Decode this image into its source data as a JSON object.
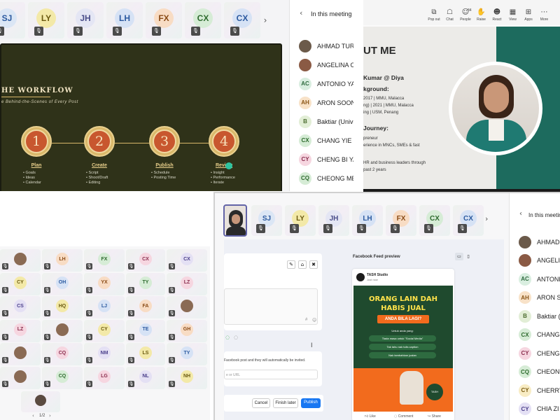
{
  "p1": {
    "tiles": [
      {
        "initials": "SJ",
        "bg": "#dbe6f5",
        "fg": "#2c5aa0"
      },
      {
        "initials": "LY",
        "bg": "#f3e9a8",
        "fg": "#6b5a10"
      },
      {
        "initials": "JH",
        "bg": "#e4e6f4",
        "fg": "#4a4e8a"
      },
      {
        "initials": "LH",
        "bg": "#d6e2f5",
        "fg": "#2c5aa0"
      },
      {
        "initials": "FX",
        "bg": "#f8dcc4",
        "fg": "#8a4b16"
      },
      {
        "initials": "CX",
        "bg": "#d6ecd6",
        "fg": "#2e6b2e"
      },
      {
        "initials": "CX",
        "bg": "#d6e2f5",
        "fg": "#2c5aa0"
      }
    ],
    "slide": {
      "title": "HE WORKFLOW",
      "subtitle": "e Behind-the-Scenes of Every Post",
      "steps": [
        {
          "num": "1",
          "title": "Plan",
          "bullets": [
            "Goals",
            "Ideas",
            "Calendar"
          ]
        },
        {
          "num": "2",
          "title": "Create",
          "bullets": [
            "Script",
            "Shoot/Draft",
            "Editing"
          ]
        },
        {
          "num": "3",
          "title": "Publish",
          "bullets": [
            "Schedule",
            "Posting Time"
          ]
        },
        {
          "num": "4",
          "title": "Review",
          "bullets": [
            "Insight",
            "Performance",
            "Iterate"
          ]
        }
      ]
    },
    "people_title": "In this meeting",
    "people": [
      {
        "name": "AHMAD TURN",
        "initials": "",
        "bg": "#6b5a4a",
        "fg": "#fff"
      },
      {
        "name": "ANGELINA OI",
        "initials": "",
        "bg": "#8a5a44",
        "fg": "#fff"
      },
      {
        "name": "ANTONIO YA",
        "initials": "AC",
        "bg": "#d9eee0",
        "fg": "#2e6b3e"
      },
      {
        "name": "ARON SOONG",
        "initials": "AH",
        "bg": "#f8e2c8",
        "fg": "#8a5516"
      },
      {
        "name": "Baktiar (Unive",
        "initials": "B",
        "bg": "#e2eed6",
        "fg": "#4a6b2e"
      },
      {
        "name": "CHANG YIE X",
        "initials": "CX",
        "bg": "#d6ecd6",
        "fg": "#2e6b2e"
      },
      {
        "name": "CHENG BI YA",
        "initials": "CY",
        "bg": "#f6d6e0",
        "fg": "#8a2e4e"
      },
      {
        "name": "CHEONG MEI",
        "initials": "CQ",
        "bg": "#d6ecd6",
        "fg": "#2e6b2e"
      }
    ]
  },
  "p2": {
    "toolbar": [
      {
        "icon": "⧉",
        "label": "Pop out",
        "name": "pop-out-icon"
      },
      {
        "icon": "☖",
        "label": "Chat",
        "name": "chat-icon"
      },
      {
        "icon": "☺",
        "label": "People",
        "name": "people-icon",
        "badge": "84"
      },
      {
        "icon": "✋",
        "label": "Raise",
        "name": "raise-hand-icon"
      },
      {
        "icon": "☻",
        "label": "React",
        "name": "react-icon"
      },
      {
        "icon": "▦",
        "label": "View",
        "name": "view-icon"
      },
      {
        "icon": "⊞",
        "label": "Apps",
        "name": "apps-icon"
      },
      {
        "icon": "⋯",
        "label": "More",
        "name": "more-icon"
      }
    ],
    "slide": {
      "heading": "UT ME",
      "name": "Kumar @ Diya",
      "bg_title": "kground:",
      "bg_lines": [
        "2017 | MMU, Malacca",
        "ng) | 2021 | MMU, Malacca",
        "ing | USM, Penang"
      ],
      "journey_title": "Journey:",
      "journey_lines": [
        "preneur",
        "erience in MNCs, SMEs & fast"
      ],
      "tail_lines": [
        "HR and business leaders through",
        "past 2 years"
      ],
      "accent": "#1d6b5e"
    }
  },
  "p3": {
    "rows": [
      [
        "",
        "LH",
        "FX",
        "CX",
        "CX"
      ],
      [
        "CY",
        "OH",
        "YX",
        "TY",
        "LZ"
      ],
      [
        "CS",
        "HQ",
        "LJ",
        "FA",
        ""
      ],
      [
        "LZ",
        "",
        "CY",
        "TE",
        "GH"
      ],
      [
        "",
        "CQ",
        "NM",
        "LS",
        "TY"
      ],
      [
        "",
        "CQ",
        "LG",
        "NL",
        "NH"
      ]
    ],
    "page": "1/2"
  },
  "p4": {
    "tiles": [
      {
        "initials": "SJ",
        "bg": "#dbe6f5",
        "fg": "#2c5aa0"
      },
      {
        "initials": "LY",
        "bg": "#f3e9a8",
        "fg": "#6b5a10"
      },
      {
        "initials": "JH",
        "bg": "#e4e6f4",
        "fg": "#4a4e8a"
      },
      {
        "initials": "LH",
        "bg": "#d6e2f5",
        "fg": "#2c5aa0"
      },
      {
        "initials": "FX",
        "bg": "#f8dcc4",
        "fg": "#8a4b16"
      },
      {
        "initials": "CX",
        "bg": "#d6ecd6",
        "fg": "#2e6b2e"
      },
      {
        "initials": "CX",
        "bg": "#d6e2f5",
        "fg": "#2c5aa0"
      }
    ],
    "preview_title": "Facebook Feed preview",
    "page_name": "TASH Studio",
    "post_time": "Just now",
    "ad_headline_1": "ORANG LAIN DAH",
    "ad_headline_2": "HABIS JUAL",
    "ad_ribbon": "ANDA BILA LAGI?",
    "ad_pills": [
      "Untuk anda yang:",
      "Tiada masa untuk \"Social Media\"",
      "Tak tahu nak tulis caption",
      "Nak tambahkan jualan"
    ],
    "ad_footer": "TASH",
    "fb_like": "Like",
    "fb_comment": "Comment",
    "fb_share": "Share",
    "invite_text": "Facebook post and they will automatically be invited.",
    "url_placeholder": "e or URL",
    "btn_cancel": "Cancel",
    "btn_later": "Finish later",
    "btn_publish": "Publish",
    "people_title": "In this meeting",
    "people": [
      {
        "name": "AHMAD TURI",
        "initials": "",
        "bg": "#6b5a4a",
        "fg": "#fff"
      },
      {
        "name": "ANGELINA C",
        "initials": "",
        "bg": "#8a5a44",
        "fg": "#fff"
      },
      {
        "name": "ANTONIO YA",
        "initials": "AC",
        "bg": "#d9eee0",
        "fg": "#2e6b3e"
      },
      {
        "name": "ARON SOON",
        "initials": "AH",
        "bg": "#f8e2c8",
        "fg": "#8a5516"
      },
      {
        "name": "Baktiar (Unive",
        "initials": "B",
        "bg": "#e2eed6",
        "fg": "#4a6b2e"
      },
      {
        "name": "CHANG YIE X",
        "initials": "CX",
        "bg": "#d6ecd6",
        "fg": "#2e6b2e"
      },
      {
        "name": "CHENG BI YA",
        "initials": "CY",
        "bg": "#f6d6e0",
        "fg": "#8a2e4e"
      },
      {
        "name": "CHEONG ME",
        "initials": "CQ",
        "bg": "#d6ecd6",
        "fg": "#2e6b2e"
      },
      {
        "name": "CHERRY LEE",
        "initials": "CY",
        "bg": "#f8ecc4",
        "fg": "#7a5a10"
      },
      {
        "name": "CHIA ZI YI",
        "initials": "CY",
        "bg": "#e4e0f4",
        "fg": "#4a3e8a"
      }
    ]
  }
}
